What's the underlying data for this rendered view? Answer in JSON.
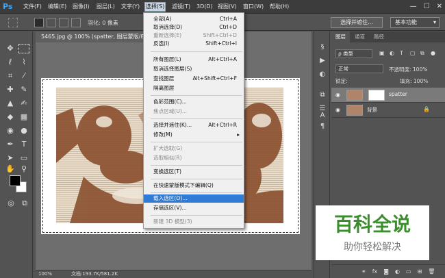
{
  "app": {
    "logo": "Ps"
  },
  "menubar": {
    "items": [
      "文件(F)",
      "编辑(E)",
      "图像(I)",
      "图层(L)",
      "文字(Y)",
      "选择(S)",
      "滤镜(T)",
      "3D(D)",
      "视图(V)",
      "窗口(W)",
      "帮助(H)"
    ],
    "active_index": 5,
    "window_controls": [
      "—",
      "☐",
      "✕"
    ]
  },
  "options": {
    "feather_label": "羽化: 0 像素",
    "select_and_mask": "选择并遮住...",
    "workspace": "基本功能"
  },
  "document": {
    "tab_title": "5465.jpg @ 100% (spatter, 图层蒙版/8) *",
    "zoom": "100%",
    "info": "文档:193.7K/581.2K"
  },
  "select_menu": {
    "items": [
      {
        "label": "全部(A)",
        "shortcut": "Ctrl+A",
        "disabled": false
      },
      {
        "label": "取消选择(D)",
        "shortcut": "Ctrl+D",
        "disabled": false
      },
      {
        "label": "重新选择(E)",
        "shortcut": "Shift+Ctrl+D",
        "disabled": true
      },
      {
        "label": "反选(I)",
        "shortcut": "Shift+Ctrl+I",
        "disabled": false
      },
      {
        "label": "所有图层(L)",
        "shortcut": "Alt+Ctrl+A",
        "disabled": false
      },
      {
        "label": "取消选择图层(S)",
        "shortcut": "",
        "disabled": false
      },
      {
        "label": "查找图层",
        "shortcut": "Alt+Shift+Ctrl+F",
        "disabled": false
      },
      {
        "label": "隔离图层",
        "shortcut": "",
        "disabled": false
      },
      {
        "label": "色彩范围(C)...",
        "shortcut": "",
        "disabled": false
      },
      {
        "label": "焦点区域(U)...",
        "shortcut": "",
        "disabled": true
      },
      {
        "label": "选择并遮住(K)...",
        "shortcut": "Alt+Ctrl+R",
        "disabled": false
      },
      {
        "label": "修改(M)",
        "shortcut": "",
        "disabled": false,
        "submenu": true
      },
      {
        "label": "扩大选取(G)",
        "shortcut": "",
        "disabled": true
      },
      {
        "label": "选取相似(R)",
        "shortcut": "",
        "disabled": true
      },
      {
        "label": "变换选区(T)",
        "shortcut": "",
        "disabled": false
      },
      {
        "label": "在快速蒙版模式下编辑(Q)",
        "shortcut": "",
        "disabled": false
      },
      {
        "label": "载入选区(O)...",
        "shortcut": "",
        "disabled": false,
        "highlighted": true
      },
      {
        "label": "存储选区(V)...",
        "shortcut": "",
        "disabled": false
      },
      {
        "label": "新建 3D 模型(3)",
        "shortcut": "",
        "disabled": true
      }
    ]
  },
  "layers_panel": {
    "tabs": [
      "图层",
      "通道",
      "路径"
    ],
    "kind_filter": "ρ 类型",
    "blend_mode": "正常",
    "opacity": "不透明度: 100%",
    "lock_label": "锁定:",
    "fill": "填充: 100%",
    "layers": [
      {
        "name": "spatter",
        "selected": true,
        "has_mask": true,
        "locked": false
      },
      {
        "name": "背景",
        "selected": false,
        "has_mask": false,
        "locked": true
      }
    ]
  },
  "watermark": {
    "title": "百科全说",
    "subtitle": "助你轻松解决"
  },
  "colors": {
    "foreground": "#000000",
    "background": "#ffffff",
    "menu_highlight": "#2f7bd6",
    "watermark_green": "#3a8f2c"
  }
}
